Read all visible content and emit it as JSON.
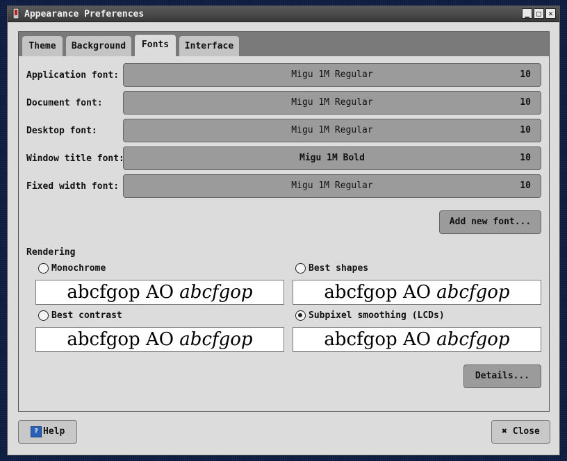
{
  "window": {
    "title": "Appearance Preferences",
    "buttons": {
      "minimize": "▁",
      "maximize": "□",
      "close": "✕"
    }
  },
  "tabs": [
    {
      "label": "Theme"
    },
    {
      "label": "Background"
    },
    {
      "label": "Fonts"
    },
    {
      "label": "Interface"
    }
  ],
  "active_tab": "Fonts",
  "fonts": [
    {
      "label": "Application font:",
      "name": "Migu 1M Regular",
      "size": "10"
    },
    {
      "label": "Document font:",
      "name": "Migu 1M Regular",
      "size": "10"
    },
    {
      "label": "Desktop font:",
      "name": "Migu 1M Regular",
      "size": "10"
    },
    {
      "label": "Window title font:",
      "name": "Migu 1M Bold",
      "size": "10"
    },
    {
      "label": "Fixed width font:",
      "name": "Migu 1M Regular",
      "size": "10"
    }
  ],
  "add_new_font": "Add new font...",
  "rendering": {
    "label": "Rendering",
    "preview_normal": "abcfgop AO ",
    "preview_italic": "abcfgop",
    "options": [
      {
        "label": "Monochrome",
        "checked": false
      },
      {
        "label": "Best shapes",
        "checked": false
      },
      {
        "label": "Best contrast",
        "checked": false
      },
      {
        "label": "Subpixel smoothing (LCDs)",
        "checked": true
      }
    ]
  },
  "details": "Details...",
  "footer": {
    "help": "Help",
    "help_icon": "?",
    "close": "Close",
    "close_icon": "✖"
  }
}
